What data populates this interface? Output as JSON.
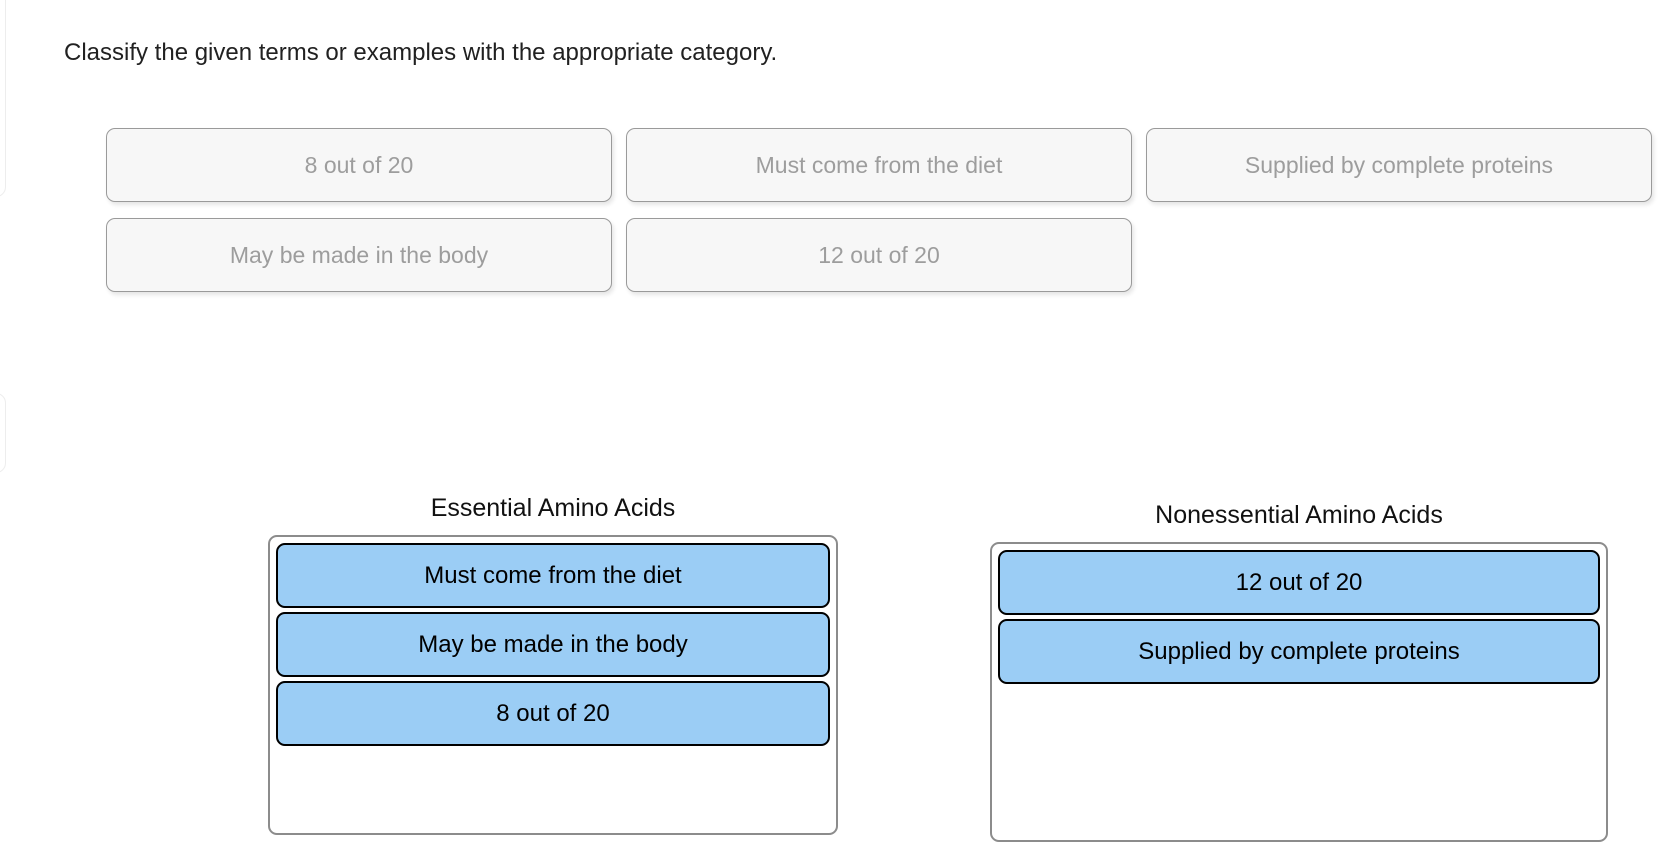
{
  "prompt": "Classify the given terms or examples with the appropriate category.",
  "bank": {
    "rows": [
      [
        {
          "label": "8 out of 20"
        },
        {
          "label": "Must come from the diet"
        },
        {
          "label": "Supplied by complete proteins"
        }
      ],
      [
        {
          "label": "May be made in the body"
        },
        {
          "label": "12 out of 20"
        }
      ]
    ]
  },
  "zones": [
    {
      "title": "Essential Amino Acids",
      "chips": [
        {
          "label": "Must come from the diet"
        },
        {
          "label": "May be made in the body"
        },
        {
          "label": "8 out of 20"
        }
      ]
    },
    {
      "title": "Nonessential Amino Acids",
      "chips": [
        {
          "label": "12 out of 20"
        },
        {
          "label": "Supplied by complete proteins"
        }
      ]
    }
  ],
  "colors": {
    "chip_fill": "#9bcdf5",
    "chip_border": "#000000",
    "bank_tile_fill": "#f7f7f7",
    "bank_tile_border": "#9a9a9a",
    "bank_tile_text": "#9d9d9d",
    "zone_border": "#8c8c8c",
    "prompt_text": "#212121"
  }
}
